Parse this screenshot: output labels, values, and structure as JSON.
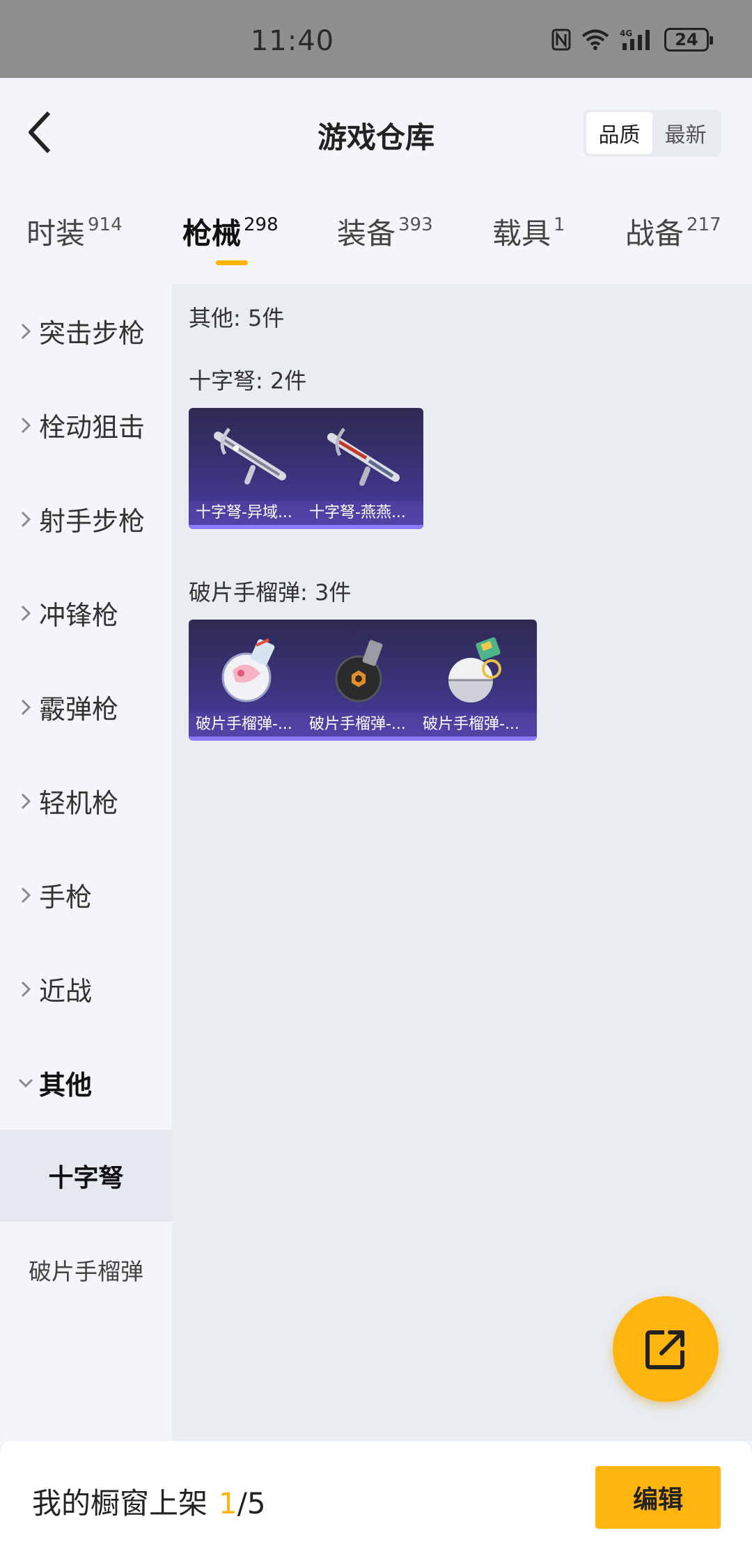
{
  "status_bar": {
    "time": "11:40",
    "signal_label": "4G",
    "battery": "24"
  },
  "header": {
    "title": "游戏仓库",
    "sort_options": [
      "品质",
      "最新"
    ],
    "active_sort": "品质"
  },
  "category_tabs": [
    {
      "label": "时装",
      "count": "914"
    },
    {
      "label": "枪械",
      "count": "298",
      "active": true
    },
    {
      "label": "装备",
      "count": "393"
    },
    {
      "label": "载具",
      "count": "1"
    },
    {
      "label": "战备",
      "count": "217"
    }
  ],
  "sidebar": {
    "items": [
      "突击步枪",
      "栓动狙击",
      "射手步枪",
      "冲锋枪",
      "霰弹枪",
      "轻机枪",
      "手枪",
      "近战",
      "其他"
    ],
    "expanded": "其他",
    "sub_items": [
      "十字弩",
      "破片手榴弹"
    ],
    "active_sub": "十字弩"
  },
  "content": {
    "section_total": "其他: 5件",
    "groups": [
      {
        "title": "十字弩: 2件",
        "items": [
          "十字弩-异域...",
          "十字弩-燕燕..."
        ]
      },
      {
        "title": "破片手榴弹: 3件",
        "items": [
          "破片手榴弹-...",
          "破片手榴弹-...",
          "破片手榴弹-..."
        ]
      }
    ]
  },
  "bottom_bar": {
    "label": "我的橱窗上架",
    "current": "1",
    "separator": "/5",
    "edit_label": "编辑"
  },
  "colors": {
    "accent": "#ffb400",
    "card_bg": "#3b3480"
  },
  "icons": {
    "back": "chevron-left-icon",
    "fab": "share-edit-icon"
  }
}
